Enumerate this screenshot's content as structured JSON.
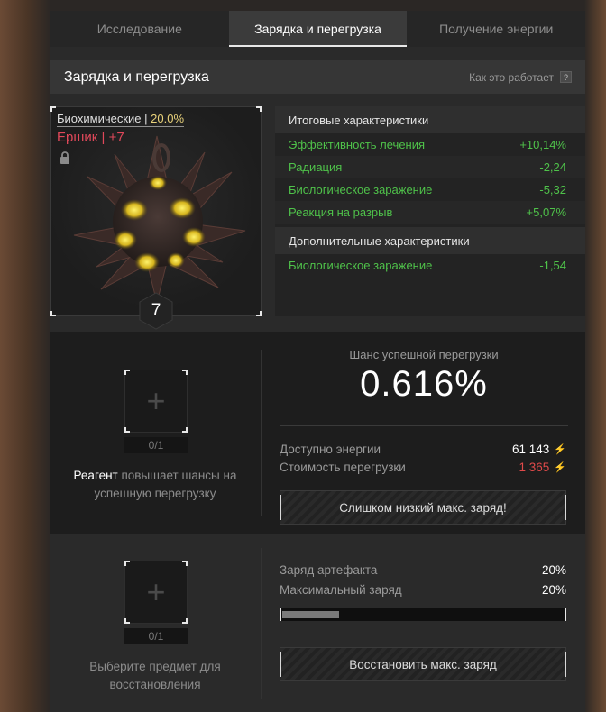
{
  "tabs": [
    {
      "label": "Исследование",
      "active": false
    },
    {
      "label": "Зарядка и перегрузка",
      "active": true
    },
    {
      "label": "Получение энергии",
      "active": false
    }
  ],
  "header": {
    "title": "Зарядка и перегрузка",
    "help_label": "Как это работает",
    "help_icon": "?"
  },
  "artifact": {
    "category": "Биохимические",
    "category_sep": " | ",
    "quality": "20.0%",
    "name": "Ершик",
    "name_sep": " | ",
    "upgrade": "+7",
    "level": "7",
    "locked": true,
    "image_icon": "spiky-artifact-icon"
  },
  "stats": {
    "total_title": "Итоговые характеристики",
    "total": [
      {
        "label": "Эффективность лечения",
        "value": "+10,14%"
      },
      {
        "label": "Радиация",
        "value": "-2,24"
      },
      {
        "label": "Биологическое заражение",
        "value": "-5,32"
      },
      {
        "label": "Реакция на разрыв",
        "value": "+5,07%"
      }
    ],
    "extra_title": "Дополнительные характеристики",
    "extra": [
      {
        "label": "Биологическое заражение",
        "value": "-1,54"
      }
    ]
  },
  "overload": {
    "reagent_slot": {
      "plus": "+",
      "count": "0/1"
    },
    "reagent_bold": "Реагент",
    "reagent_text": " повышает шансы на успешную перегрузку",
    "chance_label": "Шанс успешной перегрузки",
    "chance_value": "0.616%",
    "energy_label": "Доступно энергии",
    "energy_value": "61 143",
    "cost_label": "Стоимость перегрузки",
    "cost_value": "1 365",
    "energy_icon": "⚡",
    "button_label": "Слишком низкий макс. заряд!"
  },
  "restore": {
    "slot": {
      "plus": "+",
      "count": "0/1"
    },
    "hint": "Выберите предмет для восстановления",
    "charge_label": "Заряд артефакта",
    "charge_value": "20%",
    "max_label": "Максимальный заряд",
    "max_value": "20%",
    "bar_level": 0.2,
    "button_label": "Восстановить макс. заряд"
  },
  "colors": {
    "green": "#4fc24a",
    "red": "#e04a4a",
    "gold": "#e9d27a",
    "pink": "#e0485a"
  }
}
